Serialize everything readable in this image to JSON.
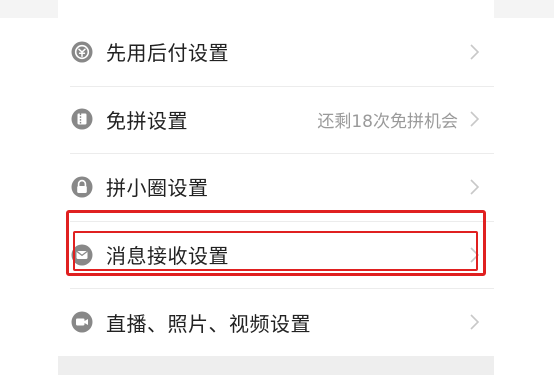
{
  "settings": {
    "items": [
      {
        "label": "先用后付设置",
        "value": "",
        "icon": "pay-later-icon"
      },
      {
        "label": "免拼设置",
        "value": "还剩18次免拼机会",
        "icon": "ticket-icon"
      },
      {
        "label": "拼小圈设置",
        "value": "",
        "icon": "lock-icon"
      },
      {
        "label": "消息接收设置",
        "value": "",
        "icon": "message-icon"
      },
      {
        "label": "直播、照片、视频设置",
        "value": "",
        "icon": "video-icon"
      }
    ]
  },
  "colors": {
    "icon": "#888888",
    "highlight": "#e02020",
    "label": "#222222",
    "secondary": "#9a9a9a"
  }
}
